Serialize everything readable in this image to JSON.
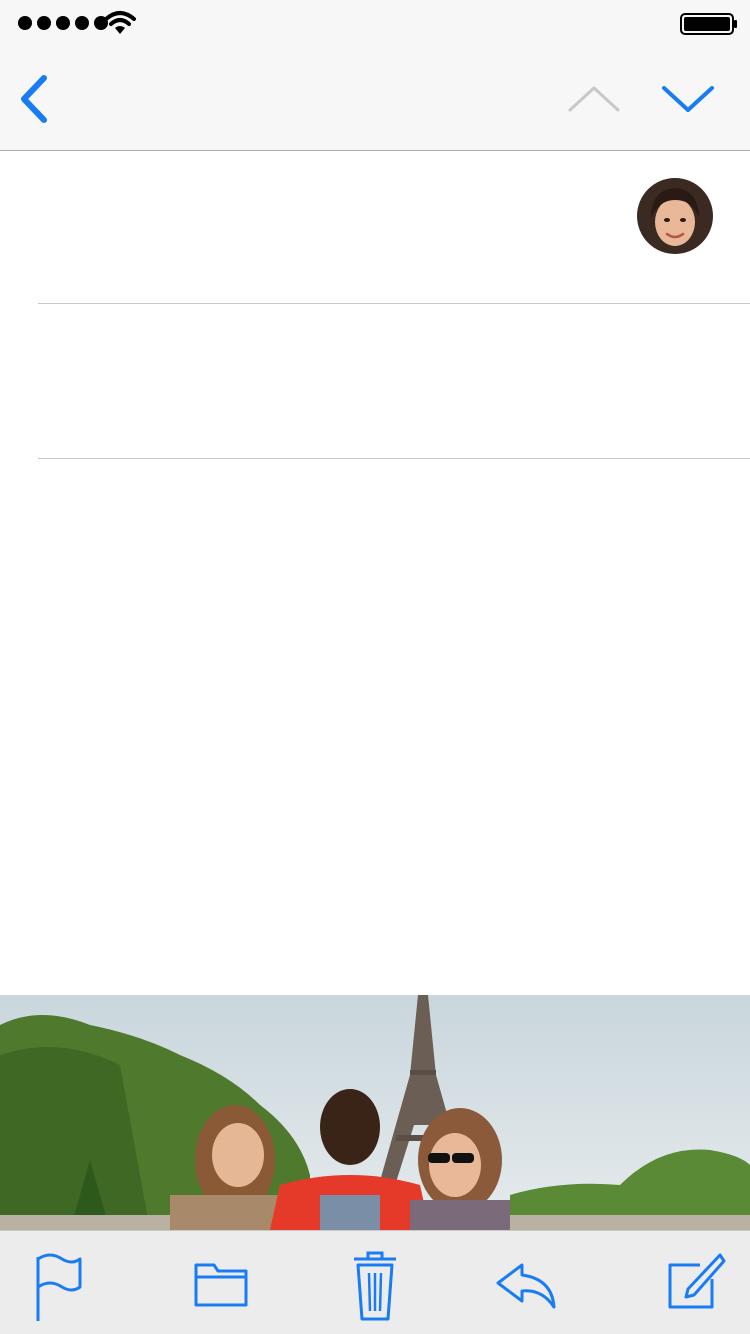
{
  "status_bar": {
    "signal_icon": "cellular-signal-icon",
    "wifi_icon": "wifi-icon",
    "battery_icon": "battery-icon"
  },
  "nav": {
    "back_icon": "chevron-left-icon",
    "previous_icon": "chevron-up-icon",
    "next_icon": "chevron-down-icon",
    "accent_color": "#1a7cf5",
    "disabled_color": "#c7c7cc"
  },
  "message": {
    "sender_avatar": "avatar",
    "attachment": "photo-of-three-friends-at-eiffel-tower"
  },
  "toolbar": {
    "items": [
      {
        "icon": "flag-icon"
      },
      {
        "icon": "folder-icon"
      },
      {
        "icon": "trash-icon"
      },
      {
        "icon": "reply-icon"
      },
      {
        "icon": "compose-icon"
      }
    ]
  }
}
